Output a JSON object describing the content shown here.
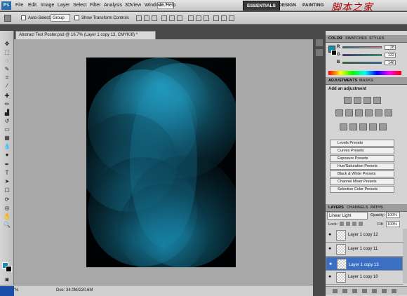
{
  "app": {
    "logo": "Ps",
    "menu": [
      "File",
      "Edit",
      "Image",
      "Layer",
      "Select",
      "Filter",
      "Analysis",
      "3D",
      "View",
      "Window",
      "Help"
    ],
    "zoom_value": "16.7",
    "workspaces": [
      "ESSENTIALS",
      "DESIGN",
      "PAINTING"
    ],
    "active_workspace": "ESSENTIALS",
    "watermark": "脚本之家"
  },
  "options_bar": {
    "auto_select_label": "Auto-Select:",
    "auto_select_value": "Group",
    "show_transform_label": "Show Transform Controls"
  },
  "document": {
    "tab_title": "Abstract Text Poster.psd @ 16.7% (Layer 1 copy 13, CMYK/8) *",
    "zoom": "16.67%",
    "doc_size": "Doc: 34.0M/220.6M"
  },
  "colors": {
    "accent": "#1a8fb8",
    "foreground": "#0e8fb0",
    "background": "#000000",
    "selection": "#3a6fc4"
  },
  "panels": {
    "color_tabs": [
      "COLOR",
      "SWATCHES",
      "STYLES"
    ],
    "color_sliders": [
      {
        "letter": "R",
        "value": "28"
      },
      {
        "letter": "G",
        "value": "122"
      },
      {
        "letter": "B",
        "value": "146"
      }
    ],
    "adjust_tabs": [
      "ADJUSTMENTS",
      "MASKS"
    ],
    "adjust_title": "Add an adjustment",
    "presets": [
      "Levels Presets",
      "Curves Presets",
      "Exposure Presets",
      "Hue/Saturation Presets",
      "Black & White Presets",
      "Channel Mixer Presets",
      "Selective Color Presets"
    ],
    "layer_tabs": [
      "LAYERS",
      "CHANNELS",
      "PATHS"
    ],
    "blend_mode": "Linear Light",
    "opacity_label": "Opacity:",
    "opacity_value": "100%",
    "lock_label": "Lock:",
    "fill_label": "Fill:",
    "fill_value": "100%",
    "layers": [
      {
        "name": "Layer 1 copy 12",
        "selected": false
      },
      {
        "name": "Layer 1 copy 11",
        "selected": false
      },
      {
        "name": "Layer 1 copy 13",
        "selected": true
      },
      {
        "name": "Layer 1 copy 10",
        "selected": false
      }
    ]
  }
}
